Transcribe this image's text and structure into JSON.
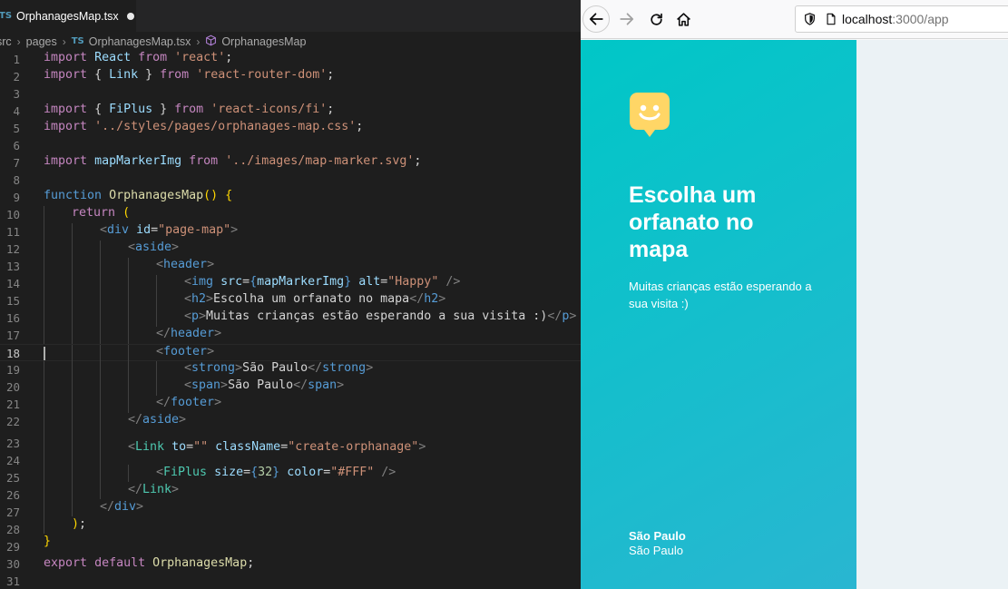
{
  "editor": {
    "tab": {
      "icon": "TS",
      "filename": "OrphanagesMap.tsx"
    },
    "breadcrumb": {
      "src": "src",
      "pages": "pages",
      "file_icon": "TS",
      "file": "OrphanagesMap.tsx",
      "symbol": "OrphanagesMap"
    },
    "lines": [
      {
        "n": "1"
      },
      {
        "n": "2"
      },
      {
        "n": "3"
      },
      {
        "n": "4"
      },
      {
        "n": "5"
      },
      {
        "n": "6"
      },
      {
        "n": "7"
      },
      {
        "n": "8"
      },
      {
        "n": "9"
      },
      {
        "n": "10"
      },
      {
        "n": "11"
      },
      {
        "n": "12"
      },
      {
        "n": "13"
      },
      {
        "n": "14"
      },
      {
        "n": "15"
      },
      {
        "n": "16"
      },
      {
        "n": "17"
      },
      {
        "n": "18"
      },
      {
        "n": "19"
      },
      {
        "n": "20"
      },
      {
        "n": "21"
      },
      {
        "n": "22"
      },
      {
        "n": "23"
      },
      {
        "n": "24"
      },
      {
        "n": "25"
      },
      {
        "n": "26"
      },
      {
        "n": "27"
      },
      {
        "n": "28"
      },
      {
        "n": "29"
      },
      {
        "n": "30"
      },
      {
        "n": "31"
      }
    ],
    "tokens": {
      "import": "import",
      "from": "from",
      "function": "function",
      "return": "return",
      "export": "export",
      "default": "default",
      "react": "React",
      "s_react": "'react'",
      "link": "Link",
      "s_router": "'react-router-dom'",
      "fiplus": "FiPlus",
      "s_icons": "'react-icons/fi'",
      "s_css": "'../styles/pages/orphanages-map.css'",
      "mapMarkerImg": "mapMarkerImg",
      "s_svg": "'../images/map-marker.svg'",
      "fn_name": "OrphanagesMap",
      "div": "div",
      "id": "id",
      "s_pagemap": "\"page-map\"",
      "aside": "aside",
      "header": "header",
      "img": "img",
      "src": "src",
      "alt": "alt",
      "s_happy": "\"Happy\"",
      "h2": "h2",
      "h2_text": "Escolha um orfanato no mapa",
      "p": "p",
      "p_text": "Muitas crianças estão esperando a sua visita :)",
      "footer": "footer",
      "strong": "strong",
      "strong_text": "São Paulo",
      "span": "span",
      "span_text": "São Paulo",
      "to": "to",
      "s_empty": "\"\"",
      "className": "className",
      "s_create": "\"create-orphanage\"",
      "size": "size",
      "n32": "32",
      "color": "color",
      "s_fff": "\"#FFF\""
    }
  },
  "browser": {
    "url_host": "localhost",
    "url_rest": ":3000/app",
    "aside": {
      "title": "Escolha um orfanato no mapa",
      "subtitle": "Muitas crianças estão esperando a sua visita :)",
      "city": "São Paulo",
      "state": "São Paulo"
    },
    "colors": {
      "gradient_start": "#29b6d1",
      "gradient_end": "#00c7c7",
      "logo": "#ffd666",
      "map_bg": "#ebf2f5"
    },
    "icons": {
      "back": "back-arrow-icon",
      "forward": "forward-arrow-icon",
      "reload": "reload-icon",
      "home": "home-icon",
      "shield": "shield-icon",
      "page": "page-icon",
      "logo": "map-marker-logo-icon"
    }
  }
}
